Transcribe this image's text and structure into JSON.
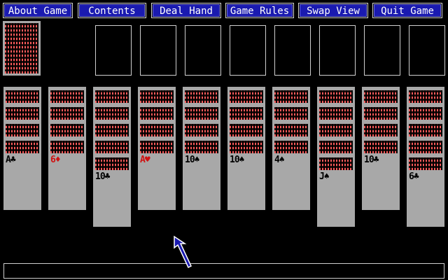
{
  "menu": [
    {
      "label": "About Game"
    },
    {
      "label": "Contents"
    },
    {
      "label": "Deal Hand"
    },
    {
      "label": "Game Rules"
    },
    {
      "label": "Swap View"
    },
    {
      "label": "Quit Game"
    }
  ],
  "colors": {
    "menu_bg": "#1a1ab0",
    "card": "#a8a8a8",
    "card_back_pattern": "#ff5a5a",
    "red_suit": "#d01010",
    "black_suit": "#000000",
    "cursor": "#1a1ab0"
  },
  "stock": {
    "face": "down"
  },
  "foundations": [
    {},
    {},
    {},
    {},
    {},
    {},
    {},
    {}
  ],
  "tableau": [
    {
      "facedown": 4,
      "card": {
        "rank": "A",
        "suit": "♣",
        "color": "black"
      }
    },
    {
      "facedown": 4,
      "card": {
        "rank": "6",
        "suit": "♦",
        "color": "red"
      }
    },
    {
      "facedown": 5,
      "card": {
        "rank": "10",
        "suit": "♣",
        "color": "black"
      }
    },
    {
      "facedown": 4,
      "card": {
        "rank": "A",
        "suit": "♥",
        "color": "red"
      }
    },
    {
      "facedown": 4,
      "card": {
        "rank": "10",
        "suit": "♠",
        "color": "black"
      }
    },
    {
      "facedown": 4,
      "card": {
        "rank": "10",
        "suit": "♠",
        "color": "black"
      }
    },
    {
      "facedown": 4,
      "card": {
        "rank": "4",
        "suit": "♠",
        "color": "black"
      }
    },
    {
      "facedown": 5,
      "card": {
        "rank": "J",
        "suit": "♠",
        "color": "black"
      }
    },
    {
      "facedown": 4,
      "card": {
        "rank": "10",
        "suit": "♣",
        "color": "black"
      }
    },
    {
      "facedown": 5,
      "card": {
        "rank": "6",
        "suit": "♣",
        "color": "black"
      }
    }
  ],
  "status_text": ""
}
